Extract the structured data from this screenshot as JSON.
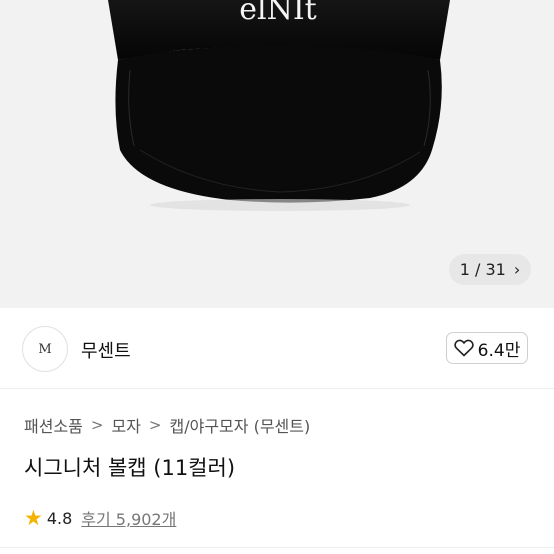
{
  "gallery": {
    "counter_current": "1",
    "counter_sep": "/",
    "counter_total": "31",
    "cap_text": "elNIt"
  },
  "brand": {
    "logo_text": "M",
    "name": "무센트"
  },
  "like": {
    "count": "6.4만"
  },
  "breadcrumb": [
    "패션소품",
    "모자",
    "캡/야구모자 (무센트)"
  ],
  "product": {
    "title": "시그니처 볼캡 (11컬러)"
  },
  "rating": {
    "score": "4.8",
    "reviews": "후기 5,902개"
  },
  "colors": {
    "star": "#f5b301",
    "cap": "#0b0b0b"
  }
}
